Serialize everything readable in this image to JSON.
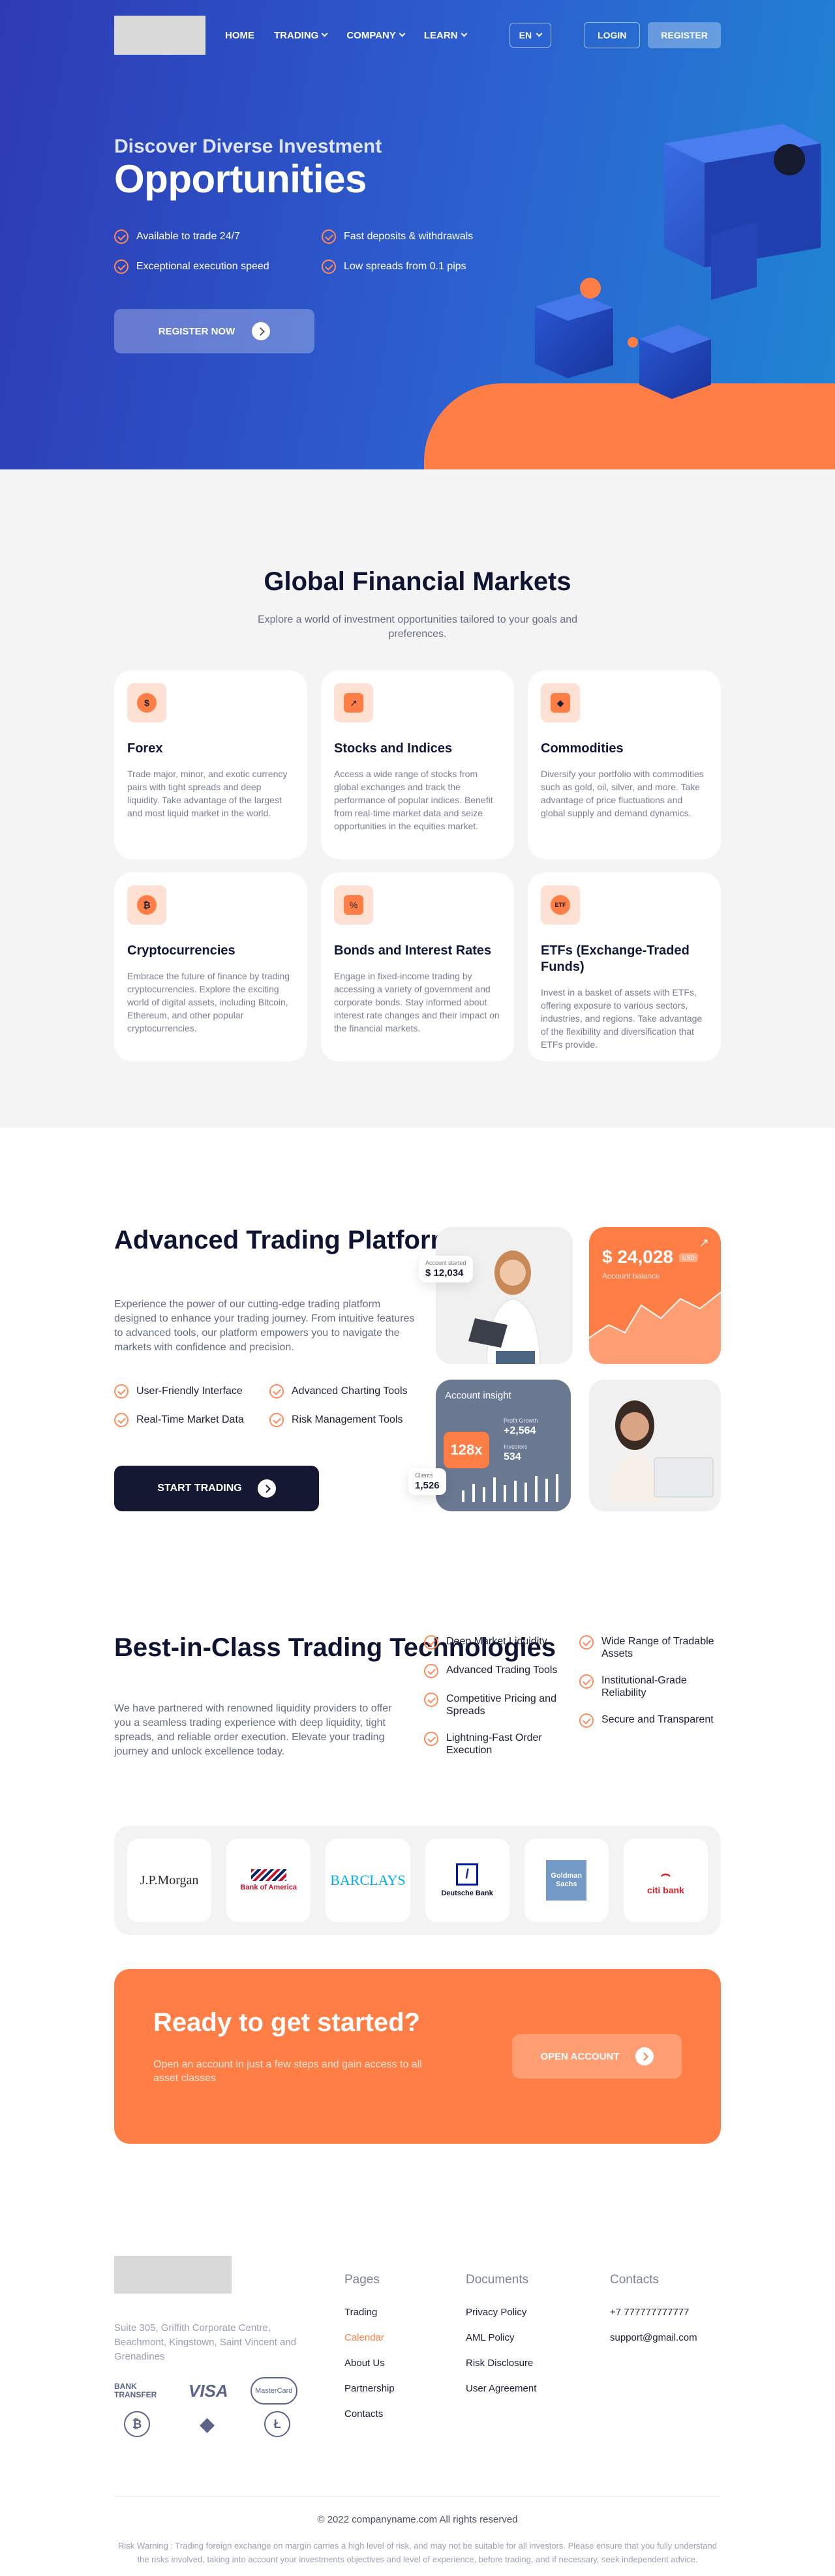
{
  "nav": {
    "links": [
      {
        "label": "HOME"
      },
      {
        "label": "TRADING"
      },
      {
        "label": "COMPANY"
      },
      {
        "label": "LEARN"
      }
    ],
    "lang": "EN",
    "login": "LOGIN",
    "register": "REGISTER"
  },
  "hero": {
    "subtitle": "Discover Diverse Investment",
    "title": "Opportunities",
    "features": [
      "Available to trade 24/7",
      "Fast deposits & withdrawals",
      "Exceptional execution speed",
      "Low spreads from 0.1 pips"
    ],
    "cta": "REGISTER NOW"
  },
  "markets": {
    "title": "Global Financial Markets",
    "lede": "Explore a world of investment opportunities tailored to your goals and preferences.",
    "cards": [
      {
        "title": "Forex",
        "icon": "dollar-coin-icon",
        "text": "Trade major, minor, and exotic currency pairs with tight spreads and deep liquidity. Take advantage of the largest and most liquid market in the world."
      },
      {
        "title": "Stocks and Indices",
        "icon": "stock-chart-icon",
        "text": "Access a wide range of stocks from global exchanges and track the performance of popular indices. Benefit from real-time market data and seize opportunities in the equities market."
      },
      {
        "title": "Commodities",
        "icon": "oil-drop-icon",
        "text": "Diversify your portfolio with commodities such as gold, oil, silver, and more. Take advantage of price fluctuations and global supply and demand dynamics."
      },
      {
        "title": "Cryptocurrencies",
        "icon": "crypto-coins-icon",
        "text": "Embrace the future of finance by trading cryptocurrencies. Explore the exciting world of digital assets, including Bitcoin, Ethereum, and other popular cryptocurrencies."
      },
      {
        "title": "Bonds and Interest Rates",
        "icon": "percent-icon",
        "text": "Engage in fixed-income trading by accessing a variety of government and corporate bonds. Stay informed about interest rate changes and their impact on the financial markets."
      },
      {
        "title": "ETFs (Exchange-Traded Funds)",
        "icon": "etf-icon",
        "text": "Invest in a basket of assets with ETFs, offering exposure to various sectors, industries, and regions. Take advantage of the flexibility and diversification that ETFs provide."
      }
    ]
  },
  "platform": {
    "title": "Advanced Trading Platform",
    "text": "Experience the power of our cutting-edge trading platform designed to enhance your trading journey. From intuitive features to advanced tools, our platform empowers you to navigate the markets with confidence and precision.",
    "features": [
      "User-Friendly Interface",
      "Advanced Charting Tools",
      "Real-Time Market Data",
      "Risk Management Tools"
    ],
    "cta": "START TRADING",
    "widgets": {
      "balance": "$ 24,028",
      "balance_badge": "USD",
      "balance_label": "Account balance",
      "account_started_label": "Account started",
      "account_started_value": "$ 12,034",
      "insight_title": "Account insight",
      "leverage": "128x",
      "profit_label": "Profit Growth",
      "profit_value": "+2,564",
      "investors_label": "Investors",
      "investors_value": "534",
      "clients_label": "Clients",
      "clients_value": "1,526"
    }
  },
  "tech": {
    "title": "Best-in-Class Trading Technologies",
    "text": "We have partnered with renowned liquidity providers to offer you a seamless trading experience with deep liquidity, tight spreads, and reliable order execution. Elevate your trading journey and unlock excellence today.",
    "features_col1": [
      "Deep Market Liquidity",
      "Advanced Trading Tools",
      "Competitive Pricing and Spreads",
      "Lightning-Fast Order Execution"
    ],
    "features_col2": [
      "Wide Range of Tradable Assets",
      "Institutional-Grade Reliability",
      "Secure and Transparent"
    ],
    "banks": [
      "J.P.Morgan",
      "Bank of America",
      "BARCLAYS",
      "Deutsche Bank",
      "Goldman Sachs",
      "citi bank"
    ],
    "colors": {
      "jpm": "#2b2b2b",
      "boa": "#c8102e",
      "barclays": "#00aeef",
      "db": "#0018a8",
      "gs": "#7399c6",
      "citi": "#e21f26"
    }
  },
  "ready": {
    "title": "Ready to get started?",
    "text": "Open an account in just a few steps and gain access to all asset classes",
    "cta": "OPEN ACCOUNT"
  },
  "footer": {
    "address": "Suite 305, Griffith Corporate Centre, Beachmont, Kingstown, Saint Vincent and Grenadines",
    "payments": [
      "BANK TRANSFER",
      "VISA",
      "MasterCard"
    ],
    "cols": [
      {
        "title": "Pages",
        "links": [
          "Trading",
          "Calendar",
          "About Us",
          "Partnership",
          "Contacts"
        ]
      },
      {
        "title": "Documents",
        "links": [
          "Privacy Policy",
          "AML Policy",
          "Risk Disclosure",
          "User Agreement"
        ]
      },
      {
        "title": "Contacts",
        "links": [
          "+7 777777777777",
          "support@gmail.com"
        ]
      }
    ],
    "copyright": "© 2022 companyname.com All rights reserved",
    "risk": "Risk Warning : Trading foreign exchange on margin carries a high level of risk, and may not be suitable for all investors. Please ensure that you fully understand the risks involved, taking into account your investments objectives and level of experience, before trading, and if necessary, seek independent advice."
  },
  "colors": {
    "accent": "#ff7e45",
    "hero_start": "#2d3ab3",
    "hero_end": "#1f86d2",
    "dark": "#141833"
  }
}
